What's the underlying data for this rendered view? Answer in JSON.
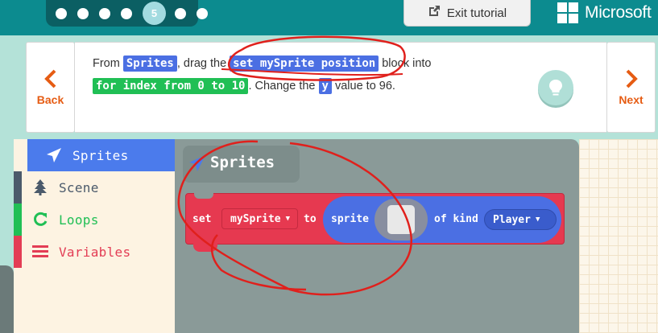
{
  "topbar": {
    "steps": {
      "current": "5"
    },
    "exit_button_label": "Exit tutorial",
    "brand": "Microsoft"
  },
  "tutorial": {
    "back_label": "Back",
    "next_label": "Next",
    "hint": {
      "part1": "From ",
      "pill1": "Sprites",
      "part2": ", drag the ",
      "pill2": "set mySprite position",
      "part3": " block into ",
      "pill3": "for index from 0 to 10",
      "part4": ". Change the ",
      "pill4": "y",
      "part5": " value to 96."
    }
  },
  "toolbox": {
    "items": [
      {
        "label": "Sprites",
        "icon": "paper-plane-icon",
        "color": "#4b7bec"
      },
      {
        "label": "Scene",
        "icon": "tree-icon",
        "color": "#4b5a6b"
      },
      {
        "label": "Loops",
        "icon": "refresh-icon",
        "color": "#20bf55"
      },
      {
        "label": "Variables",
        "icon": "list-icon",
        "color": "#e33d55"
      }
    ]
  },
  "flyout": {
    "category_title": "Sprites",
    "block": {
      "set": "set",
      "variable": "mySprite",
      "to": "to",
      "sprite": "sprite",
      "of_kind": "of kind",
      "kind": "Player"
    }
  },
  "colors": {
    "topbar": "#0c8b8f",
    "accent_orange": "#e65c13",
    "sprites_blue": "#4b7bec",
    "block_red": "#e63950",
    "annotation_red": "#e0201c"
  }
}
